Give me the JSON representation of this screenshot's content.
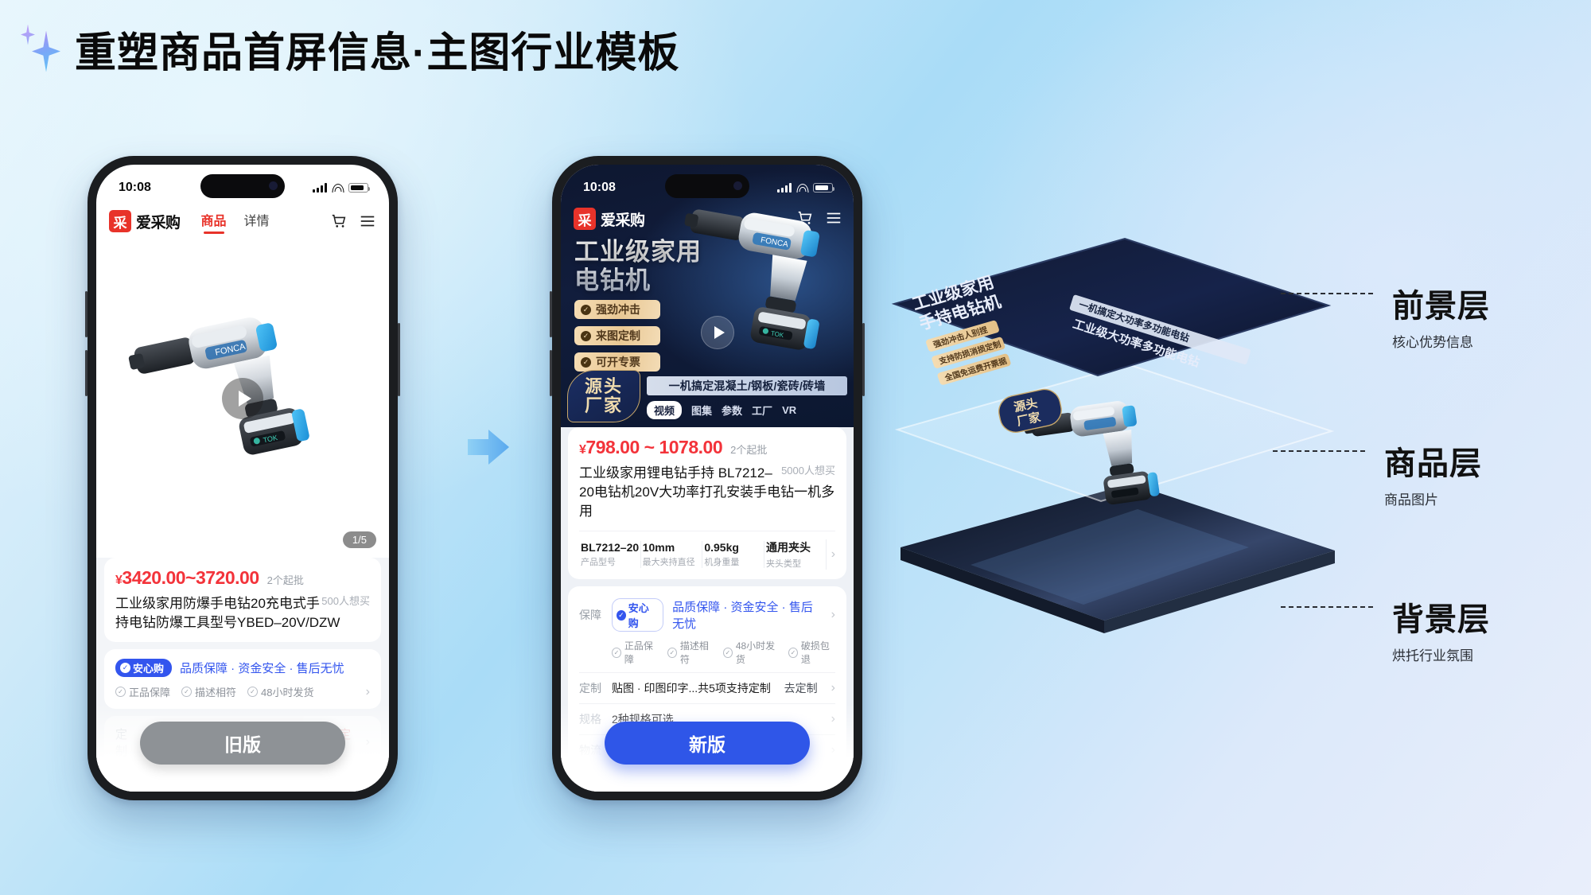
{
  "page": {
    "title": "重塑商品首屏信息·主图行业模板",
    "sparkle_icon": "sparkle-icon"
  },
  "status_bar": {
    "time": "10:08"
  },
  "old_phone": {
    "brand": {
      "logo_text": "采",
      "name": "爱采购"
    },
    "tabs": [
      {
        "label": "商品",
        "active": true
      },
      {
        "label": "详情",
        "active": false
      }
    ],
    "icons": [
      "cart-icon",
      "menu-icon"
    ],
    "gallery": {
      "counter": "1/5",
      "play": "play-icon"
    },
    "price": "3420.00~3720.00",
    "yen": "¥",
    "moq": "2个起批",
    "product_title": "工业级家用防爆手电钻20充电式手持电钻防爆工具型号YBED–20V/DZW",
    "wants": "500人想买",
    "assurance": {
      "badge": "安心购",
      "text": "品质保障 · 资金安全 · 售后无忧",
      "items": [
        "正品保障",
        "描述相符",
        "48小时发货"
      ]
    },
    "custom_row": {
      "label": "定制",
      "value": "贴图 · 印图印字印...共5项支持定制",
      "action": "我要定制"
    },
    "cta": "旧版"
  },
  "new_phone": {
    "brand": {
      "logo_text": "采",
      "name": "爱采购"
    },
    "icons": [
      "cart-icon",
      "menu-icon"
    ],
    "hero_title_line1": "工业级家用",
    "hero_title_line2": "电钻机",
    "gold_badges": [
      "强劲冲击",
      "来图定制",
      "可开专票"
    ],
    "origin_line1": "源头",
    "origin_line2": "厂家",
    "tagline": "一机搞定混凝土/钢板/瓷砖/砖墙",
    "hero_tabs": [
      {
        "label": "视频",
        "active": true
      },
      {
        "label": "图集",
        "active": false
      },
      {
        "label": "参数",
        "active": false
      },
      {
        "label": "工厂",
        "active": false
      },
      {
        "label": "VR",
        "active": false
      }
    ],
    "yen": "¥",
    "price": "798.00 ~ 1078.00",
    "moq": "2个起批",
    "product_title": "工业级家用锂电钻手持 BL7212–20电钻机20V大功率打孔安装手电钻一机多用",
    "wants": "5000人想买",
    "specs": [
      {
        "value": "BL7212–20",
        "label": "产品型号"
      },
      {
        "value": "10mm",
        "label": "最大夹持直径"
      },
      {
        "value": "0.95kg",
        "label": "机身重量"
      },
      {
        "value": "通用夹头",
        "label": "夹头类型"
      }
    ],
    "rows": [
      {
        "label": "保障",
        "badge": "安心购",
        "value": "品质保障 · 资金安全 · 售后无忧",
        "items": [
          "正品保障",
          "描述相符",
          "48小时发货",
          "破损包退"
        ],
        "action": ""
      },
      {
        "label": "定制",
        "value": "贴图 · 印图印字...共5项支持定制",
        "action": "去定制"
      },
      {
        "label": "规格",
        "value": "2种规格可选",
        "action": ""
      },
      {
        "label": "物流",
        "value": "全国包邮",
        "action": ""
      }
    ],
    "cta": "新版"
  },
  "layers": [
    {
      "title": "前景层",
      "subtitle": "核心优势信息"
    },
    {
      "title": "商品层",
      "subtitle": "商品图片"
    },
    {
      "title": "背景层",
      "subtitle": "烘托行业氛围"
    }
  ],
  "layer_art": {
    "front_title_line1": "工业级家用",
    "front_title_line2": "手持电钻机",
    "front_tagline": "一机搞定大功率多功能电钻",
    "front_badges": [
      "强劲冲击人别捏",
      "支持防损消损定制",
      "全国免运费开票据"
    ],
    "front_origin_line1": "源头",
    "front_origin_line2": "厂家"
  },
  "colors": {
    "brand_red": "#e8332a",
    "price_red": "#f3333a",
    "accent_blue": "#2f56e8",
    "assurance_blue": "#3355ee",
    "gold": "#e9c894"
  }
}
